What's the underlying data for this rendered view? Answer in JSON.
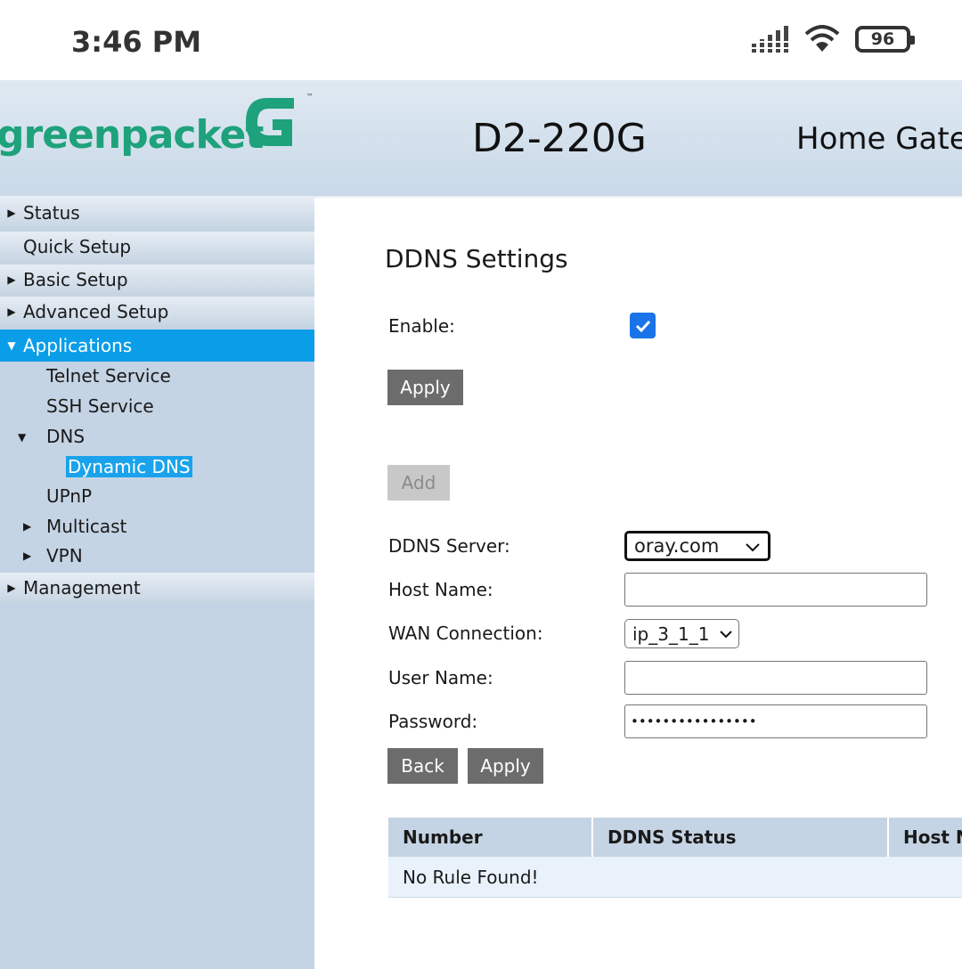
{
  "status_bar": {
    "time": "3:46 PM",
    "battery": "96"
  },
  "header": {
    "brand": "greenpacket",
    "trademark": "™",
    "model": "D2-220G",
    "title": "Home Gateway"
  },
  "sidebar": {
    "items": [
      {
        "label": "Status"
      },
      {
        "label": "Quick Setup"
      },
      {
        "label": "Basic Setup"
      },
      {
        "label": "Advanced Setup"
      },
      {
        "label": "Applications"
      },
      {
        "label": "Management"
      }
    ],
    "applications_sub": [
      {
        "label": "Telnet Service"
      },
      {
        "label": "SSH Service"
      },
      {
        "label": "DNS"
      },
      {
        "label": "Dynamic DNS"
      },
      {
        "label": "UPnP"
      },
      {
        "label": "Multicast"
      },
      {
        "label": "VPN"
      }
    ]
  },
  "content": {
    "title": "DDNS Settings",
    "enable_label": "Enable:",
    "enable_checked": true,
    "apply_label": "Apply",
    "add_label": "Add",
    "ddns_server_label": "DDNS Server:",
    "ddns_server_value": "oray.com",
    "host_name_label": "Host Name:",
    "host_name_value": "",
    "wan_connection_label": "WAN Connection:",
    "wan_connection_value": "ip_3_1_1",
    "user_name_label": "User Name:",
    "user_name_value": "",
    "password_label": "Password:",
    "password_mask": "••••••••••••••••",
    "back_label": "Back",
    "apply2_label": "Apply"
  },
  "table": {
    "headers": [
      "Number",
      "DDNS Status",
      "Host Name"
    ],
    "empty_message": "No Rule Found!"
  },
  "colors": {
    "brand_green": "#1ea27b",
    "active_blue": "#0a9de8",
    "sidebar_bg": "#c5d4e4",
    "button_gray": "#6c6c6c"
  }
}
